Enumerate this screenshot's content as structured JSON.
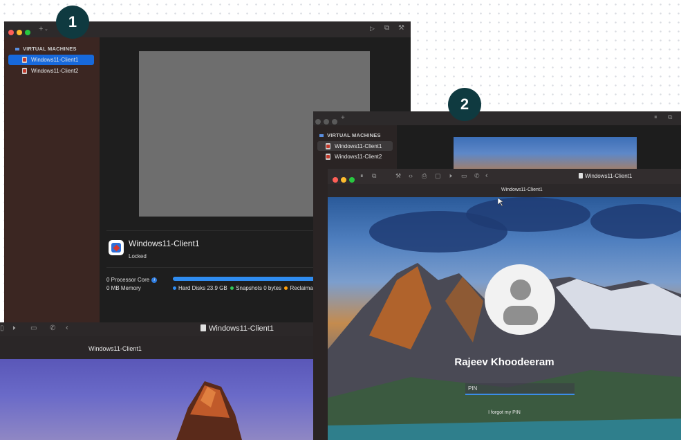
{
  "badges": {
    "one": "1",
    "two": "2"
  },
  "sidebar": {
    "section_title": "VIRTUAL MACHINES",
    "items": [
      {
        "label": "Windows11-Client1"
      },
      {
        "label": "Windows11-Client2"
      }
    ]
  },
  "toolbar": {
    "add_label": "+"
  },
  "vm_detail": {
    "name": "Windows11-Client1",
    "status": "Locked",
    "processor": "0 Processor Core",
    "memory": "0 MB Memory",
    "hard_disks_label": "Hard Disks",
    "hard_disks_value": "23.9 GB",
    "snapshots_label": "Snapshots",
    "snapshots_value": "0 bytes",
    "reclaimable_label": "Reclaimab",
    "bar_fill_fraction": 0.98,
    "colors": {
      "hard_disks": "#2f8cf0",
      "snapshots": "#34c759",
      "reclaimable": "#ff9f0a"
    }
  },
  "vm_window_bottom": {
    "title": "Windows11-Client1",
    "subtitle": "Windows11-Client1"
  },
  "vm_window_front": {
    "title": "Windows11-Client1",
    "subtitle": "Windows11-Client1",
    "user_name": "Rajeev Khoodeeram",
    "pin_placeholder": "PIN",
    "forgot_pin": "I forgot my PIN"
  }
}
